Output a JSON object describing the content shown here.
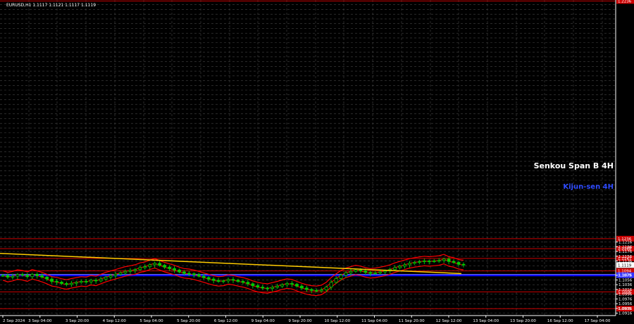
{
  "header": {
    "symbol_label": "EURUSD,H1  1.1117 1.1121 1.1117 1.1119"
  },
  "chart_data": {
    "type": "candlestick",
    "title": "EURUSD,H1",
    "ohlc_last": {
      "open": 1.1117,
      "high": 1.1121,
      "low": 1.1117,
      "close": 1.1119
    },
    "ylim": [
      1.0906,
      1.2236
    ],
    "y_ticks": [
      "1.2236",
      "1.2216",
      "1.2196",
      "1.2176",
      "1.2156",
      "1.2136",
      "1.2116",
      "1.2096",
      "1.2076",
      "1.2056",
      "1.2036",
      "1.2016",
      "1.1996",
      "1.1976",
      "1.1956",
      "1.1936",
      "1.1916",
      "1.1896",
      "1.1876",
      "1.1856",
      "1.1836",
      "1.1816",
      "1.1796",
      "1.1776",
      "1.1756",
      "1.1736",
      "1.1716",
      "1.1696",
      "1.1676",
      "1.1656",
      "1.1636",
      "1.1616",
      "1.1596",
      "1.1576",
      "1.1556",
      "1.1536",
      "1.1516",
      "1.1496",
      "1.1476",
      "1.1456",
      "1.1436",
      "1.1416",
      "1.1396",
      "1.1376",
      "1.1356",
      "1.1336",
      "1.1316",
      "1.1296",
      "1.1276",
      "1.1256",
      "1.1236",
      "1.1216",
      "1.1196",
      "1.1176",
      "1.1156",
      "1.1136",
      "1.1116",
      "1.1096",
      "1.1076",
      "1.1056",
      "1.1036",
      "1.1016",
      "1.0996",
      "1.0976",
      "1.0956",
      "1.0936",
      "1.0916"
    ],
    "y_tick_labels_visible": [
      "1.1216",
      "1.1196",
      "1.1176",
      "1.1156",
      "1.1136",
      "1.1076",
      "1.1056",
      "1.1036",
      "1.1016",
      "1.0996",
      "1.0976",
      "1.0956",
      "1.0936",
      "1.0916"
    ],
    "x_tick_labels": [
      "2 Sep 2024",
      "3 Sep 04:00",
      "3 Sep 20:00",
      "4 Sep 12:00",
      "5 Sep 04:00",
      "5 Sep 20:00",
      "6 Sep 12:00",
      "9 Sep 04:00",
      "9 Sep 20:00",
      "10 Sep 12:00",
      "11 Sep 04:00",
      "11 Sep 20:00",
      "12 Sep 12:00",
      "13 Sep 04:00",
      "13 Sep 20:00",
      "16 Sep 12:00",
      "17 Sep 04:00"
    ],
    "horizontal_levels": [
      {
        "value": 1.2236,
        "label": "1.2236",
        "color": "#cc0000"
      },
      {
        "value": 1.2236,
        "label": "1.1236",
        "color": "#cc0000"
      },
      {
        "value": 1.1188,
        "label": "1.1188",
        "color": "#cc0000"
      },
      {
        "value": 1.1147,
        "label": "1.1147",
        "color": "#cc0000"
      },
      {
        "value": 1.1094,
        "label": "1.1094",
        "color": "#cc0000"
      },
      {
        "value": 1.1006,
        "label": "1.1006",
        "color": "#cc0000"
      },
      {
        "value": 1.0935,
        "label": "1.0935",
        "color": "#cc0000"
      }
    ],
    "current_price": {
      "value": 1.1119,
      "label": "1.1119"
    },
    "senkou_level": {
      "value": 1.1076,
      "label": "1.1079",
      "color": "#8080ff"
    },
    "indicator_labels": {
      "senkou": "Senkou Span B 4H",
      "kijun": "Kijun-sen 4H"
    },
    "trendline": {
      "color": "#e6c200",
      "from": [
        "2 Sep 2024",
        1.1168
      ],
      "to": [
        "17 Sep 04:00",
        1.1083
      ]
    },
    "series_colors": {
      "up_candle": "#00cc00",
      "down_candle": "#00cc00",
      "bands": "#ff0000",
      "trend": "#ffcc00",
      "kijun": "#0000ff"
    },
    "close_path": [
      1.1075,
      1.1068,
      1.1072,
      1.1079,
      1.1076,
      1.107,
      1.108,
      1.1074,
      1.1068,
      1.106,
      1.105,
      1.1047,
      1.1041,
      1.1037,
      1.1042,
      1.1046,
      1.105,
      1.1048,
      1.1055,
      1.1052,
      1.106,
      1.1068,
      1.1074,
      1.108,
      1.1086,
      1.1092,
      1.1096,
      1.11,
      1.1108,
      1.1112,
      1.112,
      1.1126,
      1.1118,
      1.111,
      1.1104,
      1.1098,
      1.109,
      1.1084,
      1.1082,
      1.1078,
      1.1072,
      1.1066,
      1.106,
      1.1054,
      1.105,
      1.1052,
      1.1058,
      1.1055,
      1.105,
      1.1046,
      1.104,
      1.1032,
      1.1026,
      1.1022,
      1.102,
      1.1025,
      1.103,
      1.1036,
      1.1041,
      1.1038,
      1.103,
      1.1022,
      1.1016,
      1.1012,
      1.101,
      1.1014,
      1.1026,
      1.1046,
      1.1062,
      1.1076,
      1.1086,
      1.1092,
      1.1098,
      1.1094,
      1.1088,
      1.1084,
      1.1086,
      1.109,
      1.1094,
      1.11,
      1.1108,
      1.1114,
      1.112,
      1.1126,
      1.113,
      1.1133,
      1.1136,
      1.1134,
      1.1136,
      1.1138,
      1.1144,
      1.1134,
      1.113,
      1.1122,
      1.1119
    ]
  }
}
